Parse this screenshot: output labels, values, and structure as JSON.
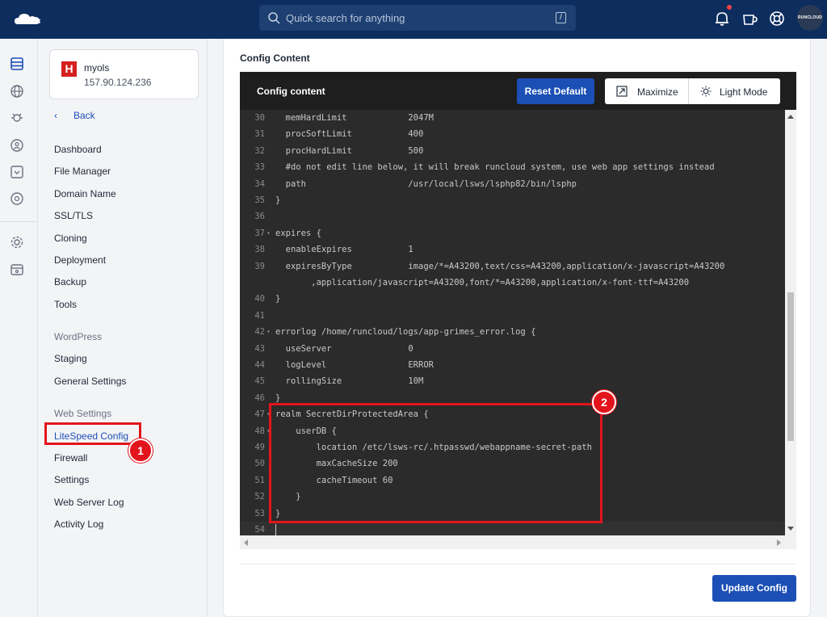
{
  "topbar": {
    "search_placeholder": "Quick search for anything",
    "search_shortcut": "/",
    "brand_badge": "RUNCLOUD"
  },
  "server": {
    "name": "myols",
    "ip": "157.90.124.236"
  },
  "sidenav": {
    "back_label": "Back",
    "items": [
      {
        "label": "Dashboard"
      },
      {
        "label": "File Manager"
      },
      {
        "label": "Domain Name"
      },
      {
        "label": "SSL/TLS"
      },
      {
        "label": "Cloning"
      },
      {
        "label": "Deployment"
      },
      {
        "label": "Backup"
      },
      {
        "label": "Tools"
      }
    ],
    "group_wordpress": "WordPress",
    "wp_items": [
      {
        "label": "Staging"
      },
      {
        "label": "General Settings"
      }
    ],
    "group_web": "Web Settings",
    "web_items": [
      {
        "label": "LiteSpeed Config"
      },
      {
        "label": "Firewall"
      },
      {
        "label": "Settings"
      },
      {
        "label": "Web Server Log"
      },
      {
        "label": "Activity Log"
      }
    ]
  },
  "main": {
    "section_title": "Config Content",
    "editor_title": "Config content",
    "reset_label": "Reset Default",
    "maximize_label": "Maximize",
    "lightmode_label": "Light Mode",
    "update_label": "Update Config"
  },
  "annotations": {
    "marker1": "1",
    "marker2": "2"
  },
  "code": {
    "lines": [
      {
        "n": "30",
        "fold": "",
        "text": "  memHardLimit            2047M"
      },
      {
        "n": "31",
        "fold": "",
        "text": "  procSoftLimit           400"
      },
      {
        "n": "32",
        "fold": "",
        "text": "  procHardLimit           500"
      },
      {
        "n": "33",
        "fold": "",
        "text": "  #do not edit line below, it will break runcloud system, use web app settings instead"
      },
      {
        "n": "34",
        "fold": "",
        "text": "  path                    /usr/local/lsws/lsphp82/bin/lsphp"
      },
      {
        "n": "35",
        "fold": "",
        "text": "}"
      },
      {
        "n": "36",
        "fold": "",
        "text": ""
      },
      {
        "n": "37",
        "fold": "▾",
        "text": "expires {"
      },
      {
        "n": "38",
        "fold": "",
        "text": "  enableExpires           1"
      },
      {
        "n": "39",
        "fold": "",
        "text": "  expiresByType           image/*=A43200,text/css=A43200,application/x-javascript=A43200"
      },
      {
        "n": "",
        "fold": "",
        "text": "       ,application/javascript=A43200,font/*=A43200,application/x-font-ttf=A43200"
      },
      {
        "n": "40",
        "fold": "",
        "text": "}"
      },
      {
        "n": "41",
        "fold": "",
        "text": ""
      },
      {
        "n": "42",
        "fold": "▾",
        "text": "errorlog /home/runcloud/logs/app-grimes_error.log {"
      },
      {
        "n": "43",
        "fold": "",
        "text": "  useServer               0"
      },
      {
        "n": "44",
        "fold": "",
        "text": "  logLevel                ERROR"
      },
      {
        "n": "45",
        "fold": "",
        "text": "  rollingSize             10M"
      },
      {
        "n": "46",
        "fold": "",
        "text": "}"
      },
      {
        "n": "47",
        "fold": "▾",
        "text": "realm SecretDirProtectedArea {"
      },
      {
        "n": "48",
        "fold": "▾",
        "text": "    userDB {"
      },
      {
        "n": "49",
        "fold": "",
        "text": "        location /etc/lsws-rc/.htpasswd/webappname-secret-path"
      },
      {
        "n": "50",
        "fold": "",
        "text": "        maxCacheSize 200"
      },
      {
        "n": "51",
        "fold": "",
        "text": "        cacheTimeout 60"
      },
      {
        "n": "52",
        "fold": "",
        "text": "    }"
      },
      {
        "n": "53",
        "fold": "",
        "text": "}"
      },
      {
        "n": "54",
        "fold": "",
        "text": ""
      }
    ]
  },
  "colors": {
    "brand_blue": "#1b4fb5",
    "topbar": "#0c2d5e",
    "highlight_red": "#e3141c",
    "editor_bg": "#2b2b2b"
  }
}
